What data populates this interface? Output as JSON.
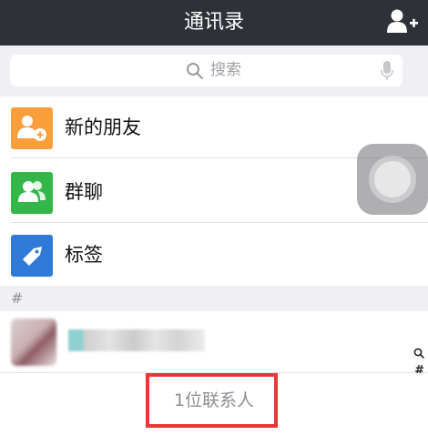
{
  "navbar": {
    "title": "通讯录",
    "add_contact_icon": "add-contact-icon"
  },
  "search": {
    "placeholder": "搜索",
    "search_icon": "search-icon",
    "mic_icon": "microphone-icon"
  },
  "fixed_items": [
    {
      "label": "新的朋友",
      "icon": "new-friend-icon",
      "icon_color": "#fa9d3b"
    },
    {
      "label": "群聊",
      "icon": "group-chat-icon",
      "icon_color": "#33b749"
    },
    {
      "label": "标签",
      "icon": "tag-icon",
      "icon_color": "#2f7ad9"
    }
  ],
  "section": {
    "header": "#"
  },
  "index_bar": {
    "items": [
      "search",
      "#"
    ],
    "hash": "#"
  },
  "footer": {
    "count_text": "1位联系人",
    "highlight_color": "#e53935"
  },
  "colors": {
    "navbar_bg": "#2e3238",
    "page_bg": "#efeff4",
    "secondary_text": "#8e8e93"
  }
}
